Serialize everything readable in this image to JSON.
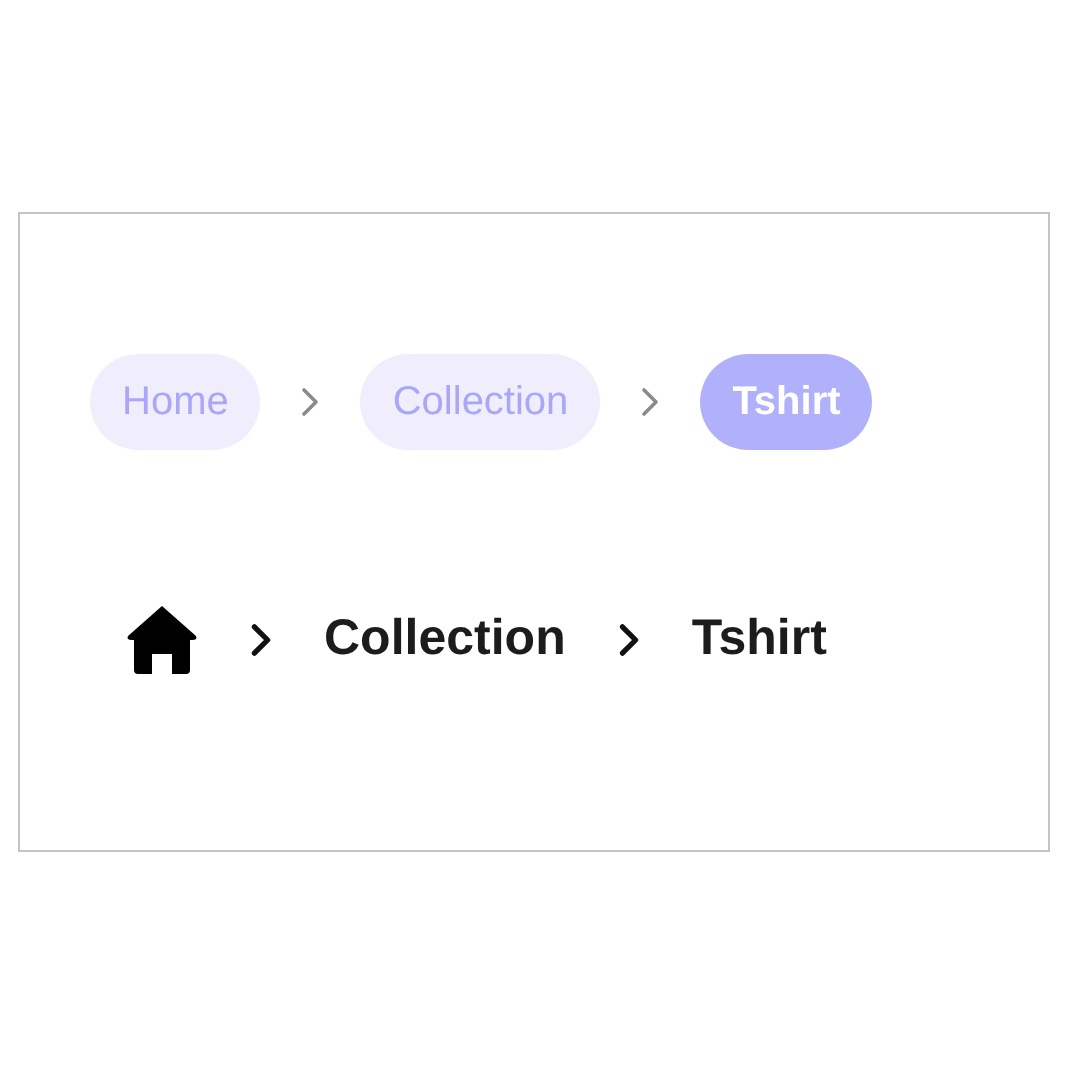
{
  "pill_breadcrumb": {
    "items": [
      {
        "label": "Home",
        "selected": false
      },
      {
        "label": "Collection",
        "selected": false
      },
      {
        "label": "Tshirt",
        "selected": true
      }
    ]
  },
  "plain_breadcrumb": {
    "items": [
      {
        "kind": "home"
      },
      {
        "kind": "text",
        "label": "Collection"
      },
      {
        "kind": "text",
        "label": "Tshirt"
      }
    ]
  }
}
